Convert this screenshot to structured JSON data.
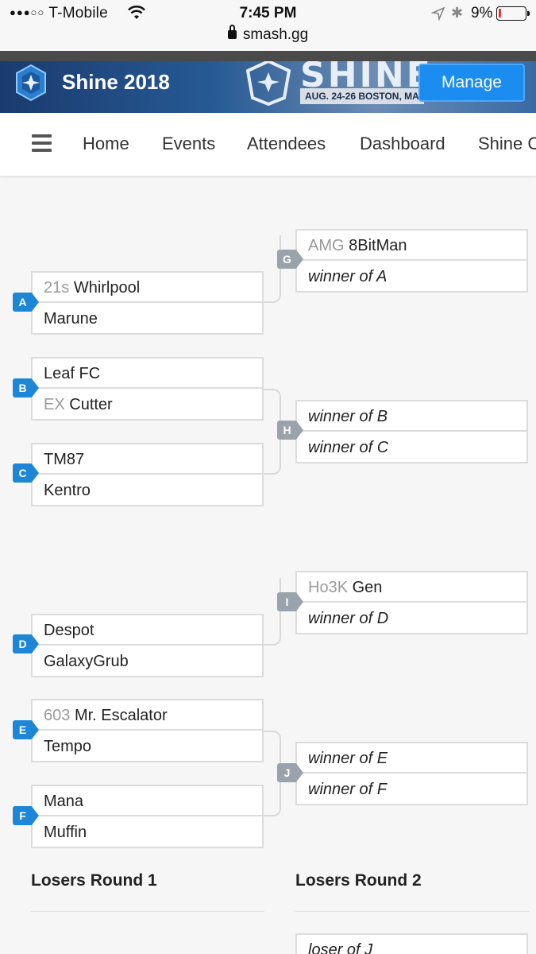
{
  "status_bar": {
    "carrier": "T-Mobile",
    "signal": "●●●○○",
    "time": "7:45 PM",
    "url": "smash.gg",
    "battery_percent": "9%",
    "battery_level": 0.09
  },
  "banner": {
    "title": "Shine 2018",
    "art_word": "SHINE",
    "art_date": "AUG. 24-26 BOSTON, MA",
    "manage_label": "Manage"
  },
  "nav": {
    "items": [
      "Home",
      "Events",
      "Attendees",
      "Dashboard",
      "Shine C"
    ]
  },
  "bracket": {
    "losers_round_1": [
      {
        "id": "A",
        "p1_prefix": "21s",
        "p1": "Whirlpool",
        "p2_prefix": "",
        "p2": "Marune"
      },
      {
        "id": "B",
        "p1_prefix": "",
        "p1": "Leaf FC",
        "p2_prefix": "EX",
        "p2": "Cutter"
      },
      {
        "id": "C",
        "p1_prefix": "",
        "p1": "TM87",
        "p2_prefix": "",
        "p2": "Kentro"
      },
      {
        "id": "D",
        "p1_prefix": "",
        "p1": "Despot",
        "p2_prefix": "",
        "p2": "GalaxyGrub"
      },
      {
        "id": "E",
        "p1_prefix": "603",
        "p1": "Mr. Escalator",
        "p2_prefix": "",
        "p2": "Tempo"
      },
      {
        "id": "F",
        "p1_prefix": "",
        "p1": "Mana",
        "p2_prefix": "",
        "p2": "Muffin"
      }
    ],
    "losers_round_2": [
      {
        "id": "G",
        "p1_prefix": "AMG",
        "p1": "8BitMan",
        "p2_placeholder": "winner of A"
      },
      {
        "id": "H",
        "p1_placeholder": "winner of B",
        "p2_placeholder": "winner of C"
      },
      {
        "id": "I",
        "p1_prefix": "Ho3K",
        "p1": "Gen",
        "p2_placeholder": "winner of D"
      },
      {
        "id": "J",
        "p1_placeholder": "winner of E",
        "p2_placeholder": "winner of F"
      }
    ],
    "round_headings": [
      "Losers Round 1",
      "Losers Round 2"
    ],
    "next_slot_placeholder": "loser of J"
  },
  "colors": {
    "badge_blue": "#1d86d6",
    "badge_gray": "#9aa2ac",
    "manage_button": "#1b8cf0"
  }
}
